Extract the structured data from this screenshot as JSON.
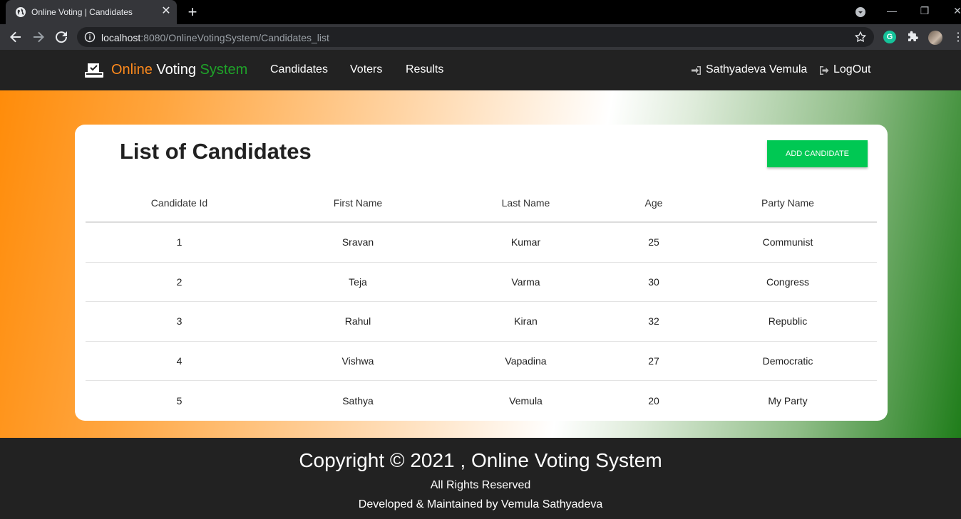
{
  "browser": {
    "tab_title": "Online Voting | Candidates",
    "url_host": "localhost",
    "url_rest": ":8080/OnlineVotingSystem/Candidates_list",
    "extension_letter": "G"
  },
  "navbar": {
    "brand_word1": "Online",
    "brand_word2": "Voting",
    "brand_word3": "System",
    "links": [
      "Candidates",
      "Voters",
      "Results"
    ],
    "user_name": "Sathyadeva Vemula",
    "logout": "LogOut"
  },
  "colors": {
    "brand_orange": "#ff8a1c",
    "brand_green": "#1fa329",
    "add_button": "#00c853",
    "navbar_bg": "#222222"
  },
  "page": {
    "title": "List of Candidates",
    "add_button_label": "ADD CANDIDATE"
  },
  "table": {
    "headers": [
      "Candidate Id",
      "First Name",
      "Last Name",
      "Age",
      "Party Name"
    ],
    "rows": [
      [
        "1",
        "Sravan",
        "Kumar",
        "25",
        "Communist"
      ],
      [
        "2",
        "Teja",
        "Varma",
        "30",
        "Congress"
      ],
      [
        "3",
        "Rahul",
        "Kiran",
        "32",
        "Republic"
      ],
      [
        "4",
        "Vishwa",
        "Vapadina",
        "27",
        "Democratic"
      ],
      [
        "5",
        "Sathya",
        "Vemula",
        "20",
        "My Party"
      ]
    ]
  },
  "footer": {
    "copyright": "Copyright © 2021 , Online Voting System",
    "rights": "All Rights Reserved",
    "developer": "Developed & Maintained by Vemula Sathyadeva"
  },
  "icons": {
    "tab_favicon": "globe-icon",
    "brand": "ballot-box-icon",
    "user": "sign-in-icon",
    "logout": "sign-out-icon"
  }
}
